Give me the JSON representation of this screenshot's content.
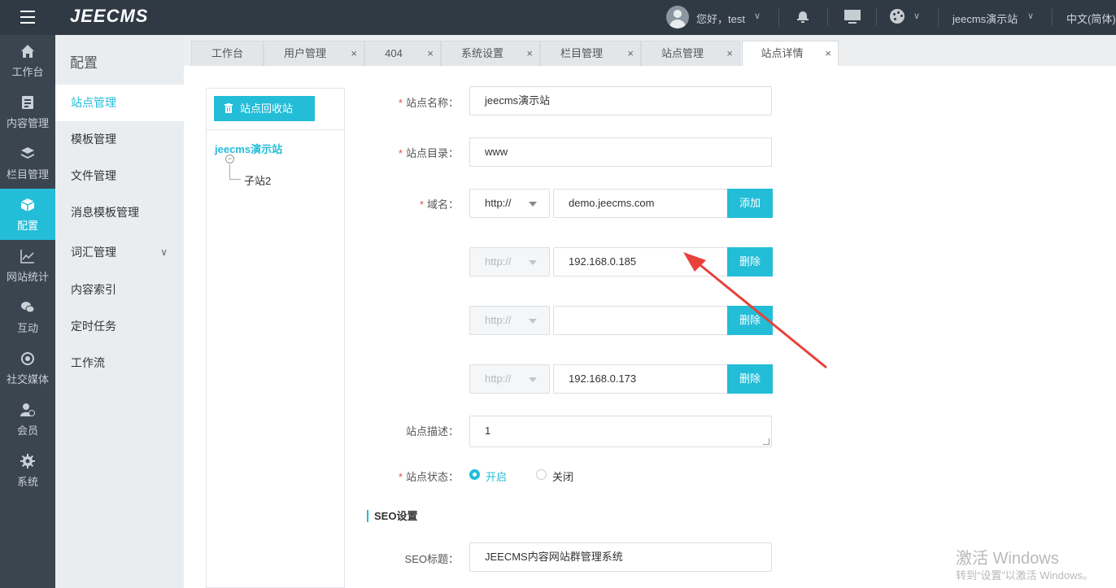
{
  "topbar": {
    "logo": "JEECMS",
    "greeting": "您好，test",
    "site_name": "jeecms演示站",
    "language": "中文(简体)"
  },
  "leftnav": {
    "items": [
      {
        "label": "工作台",
        "icon": "home-icon"
      },
      {
        "label": "内容管理",
        "icon": "document-icon"
      },
      {
        "label": "栏目管理",
        "icon": "layers-icon"
      },
      {
        "label": "配置",
        "icon": "cube-icon",
        "active": true
      },
      {
        "label": "网站统计",
        "icon": "chart-line-icon"
      },
      {
        "label": "互动",
        "icon": "chat-icon"
      },
      {
        "label": "社交媒体",
        "icon": "target-icon"
      },
      {
        "label": "会员",
        "icon": "member-icon"
      },
      {
        "label": "系统",
        "icon": "gear-icon"
      }
    ]
  },
  "submenu": {
    "title": "配置",
    "items": [
      {
        "label": "站点管理",
        "active": true
      },
      {
        "label": "模板管理"
      },
      {
        "label": "文件管理"
      },
      {
        "label": "消息模板管理"
      },
      {
        "label": "词汇管理"
      },
      {
        "label": "内容索引"
      },
      {
        "label": "定时任务"
      },
      {
        "label": "工作流"
      }
    ]
  },
  "tabs": [
    {
      "label": "工作台"
    },
    {
      "label": "用户管理"
    },
    {
      "label": "404"
    },
    {
      "label": "系统设置"
    },
    {
      "label": "栏目管理"
    },
    {
      "label": "站点管理"
    },
    {
      "label": "站点详情",
      "active": true
    }
  ],
  "tab_close": "×",
  "tree": {
    "recycle_button": "站点回收站",
    "root": "jeecms演示站",
    "toggle": "−",
    "children": [
      "子站2"
    ]
  },
  "form": {
    "site_name_label": "站点名称：",
    "site_name_value": "jeecms演示站",
    "site_dir_label": "站点目录：",
    "site_dir_value": "www",
    "domain_label": "域名：",
    "domains": [
      {
        "protocol": "http://",
        "value": "demo.jeecms.com",
        "button": "添加"
      },
      {
        "protocol": "http://",
        "value": "192.168.0.185",
        "button": "删除"
      },
      {
        "protocol": "http://",
        "value": "",
        "button": "删除"
      },
      {
        "protocol": "http://",
        "value": "192.168.0.173",
        "button": "删除"
      }
    ],
    "desc_label": "站点描述：",
    "desc_value": "1",
    "status_label": "站点状态：",
    "status_options": [
      {
        "label": "开启",
        "checked": true
      },
      {
        "label": "关闭",
        "checked": false
      }
    ],
    "seo_section": "SEO设置",
    "seo_title_label": "SEO标题：",
    "seo_title_value": "JEECMS内容网站群管理系统"
  },
  "watermark": {
    "line1": "激活 Windows",
    "line2": "转到“设置”以激活 Windows。"
  },
  "colors": {
    "accent": "#23bdd8",
    "topbar": "#2f3a45",
    "leftnav": "#3a4550",
    "required": "#e24b4b",
    "arrow": "#e8413a"
  }
}
